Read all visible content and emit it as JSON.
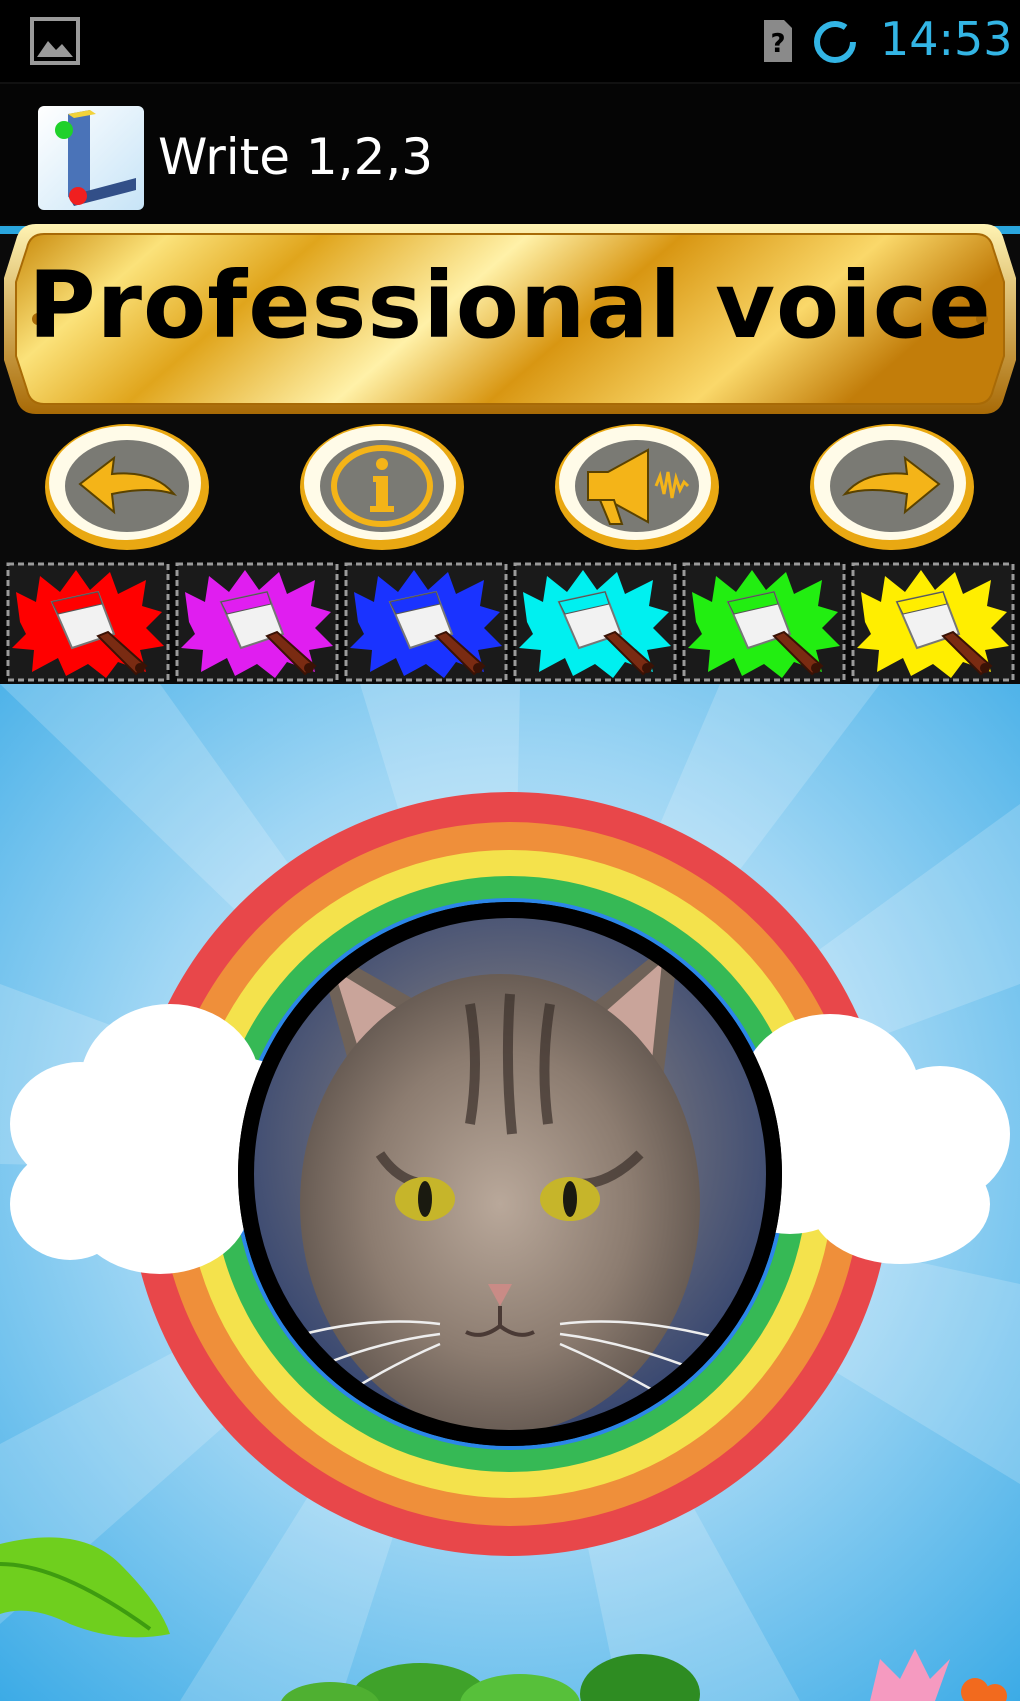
{
  "status_bar": {
    "time": "14:53",
    "icons": [
      "gallery-icon",
      "sim-unknown-icon",
      "sync-icon"
    ],
    "time_color": "#33b5e5"
  },
  "action_bar": {
    "title": "Write 1,2,3",
    "icon": "app-icon"
  },
  "banner": {
    "text": "Professional voice"
  },
  "nav_buttons": [
    {
      "name": "back-button",
      "icon": "arrow-left-icon"
    },
    {
      "name": "info-button",
      "icon": "info-icon"
    },
    {
      "name": "sound-button",
      "icon": "megaphone-icon"
    },
    {
      "name": "next-button",
      "icon": "arrow-right-icon"
    }
  ],
  "paint_colors": [
    {
      "name": "red",
      "hex": "#ff0000"
    },
    {
      "name": "magenta",
      "hex": "#e01ef0"
    },
    {
      "name": "blue",
      "hex": "#1a33ff"
    },
    {
      "name": "cyan",
      "hex": "#00f0f0"
    },
    {
      "name": "green",
      "hex": "#22ee11"
    },
    {
      "name": "yellow",
      "hex": "#ffee00"
    }
  ],
  "colors": {
    "accent": "#33b5e5",
    "sky": "#48b6ea",
    "gold": "#e9b323"
  }
}
